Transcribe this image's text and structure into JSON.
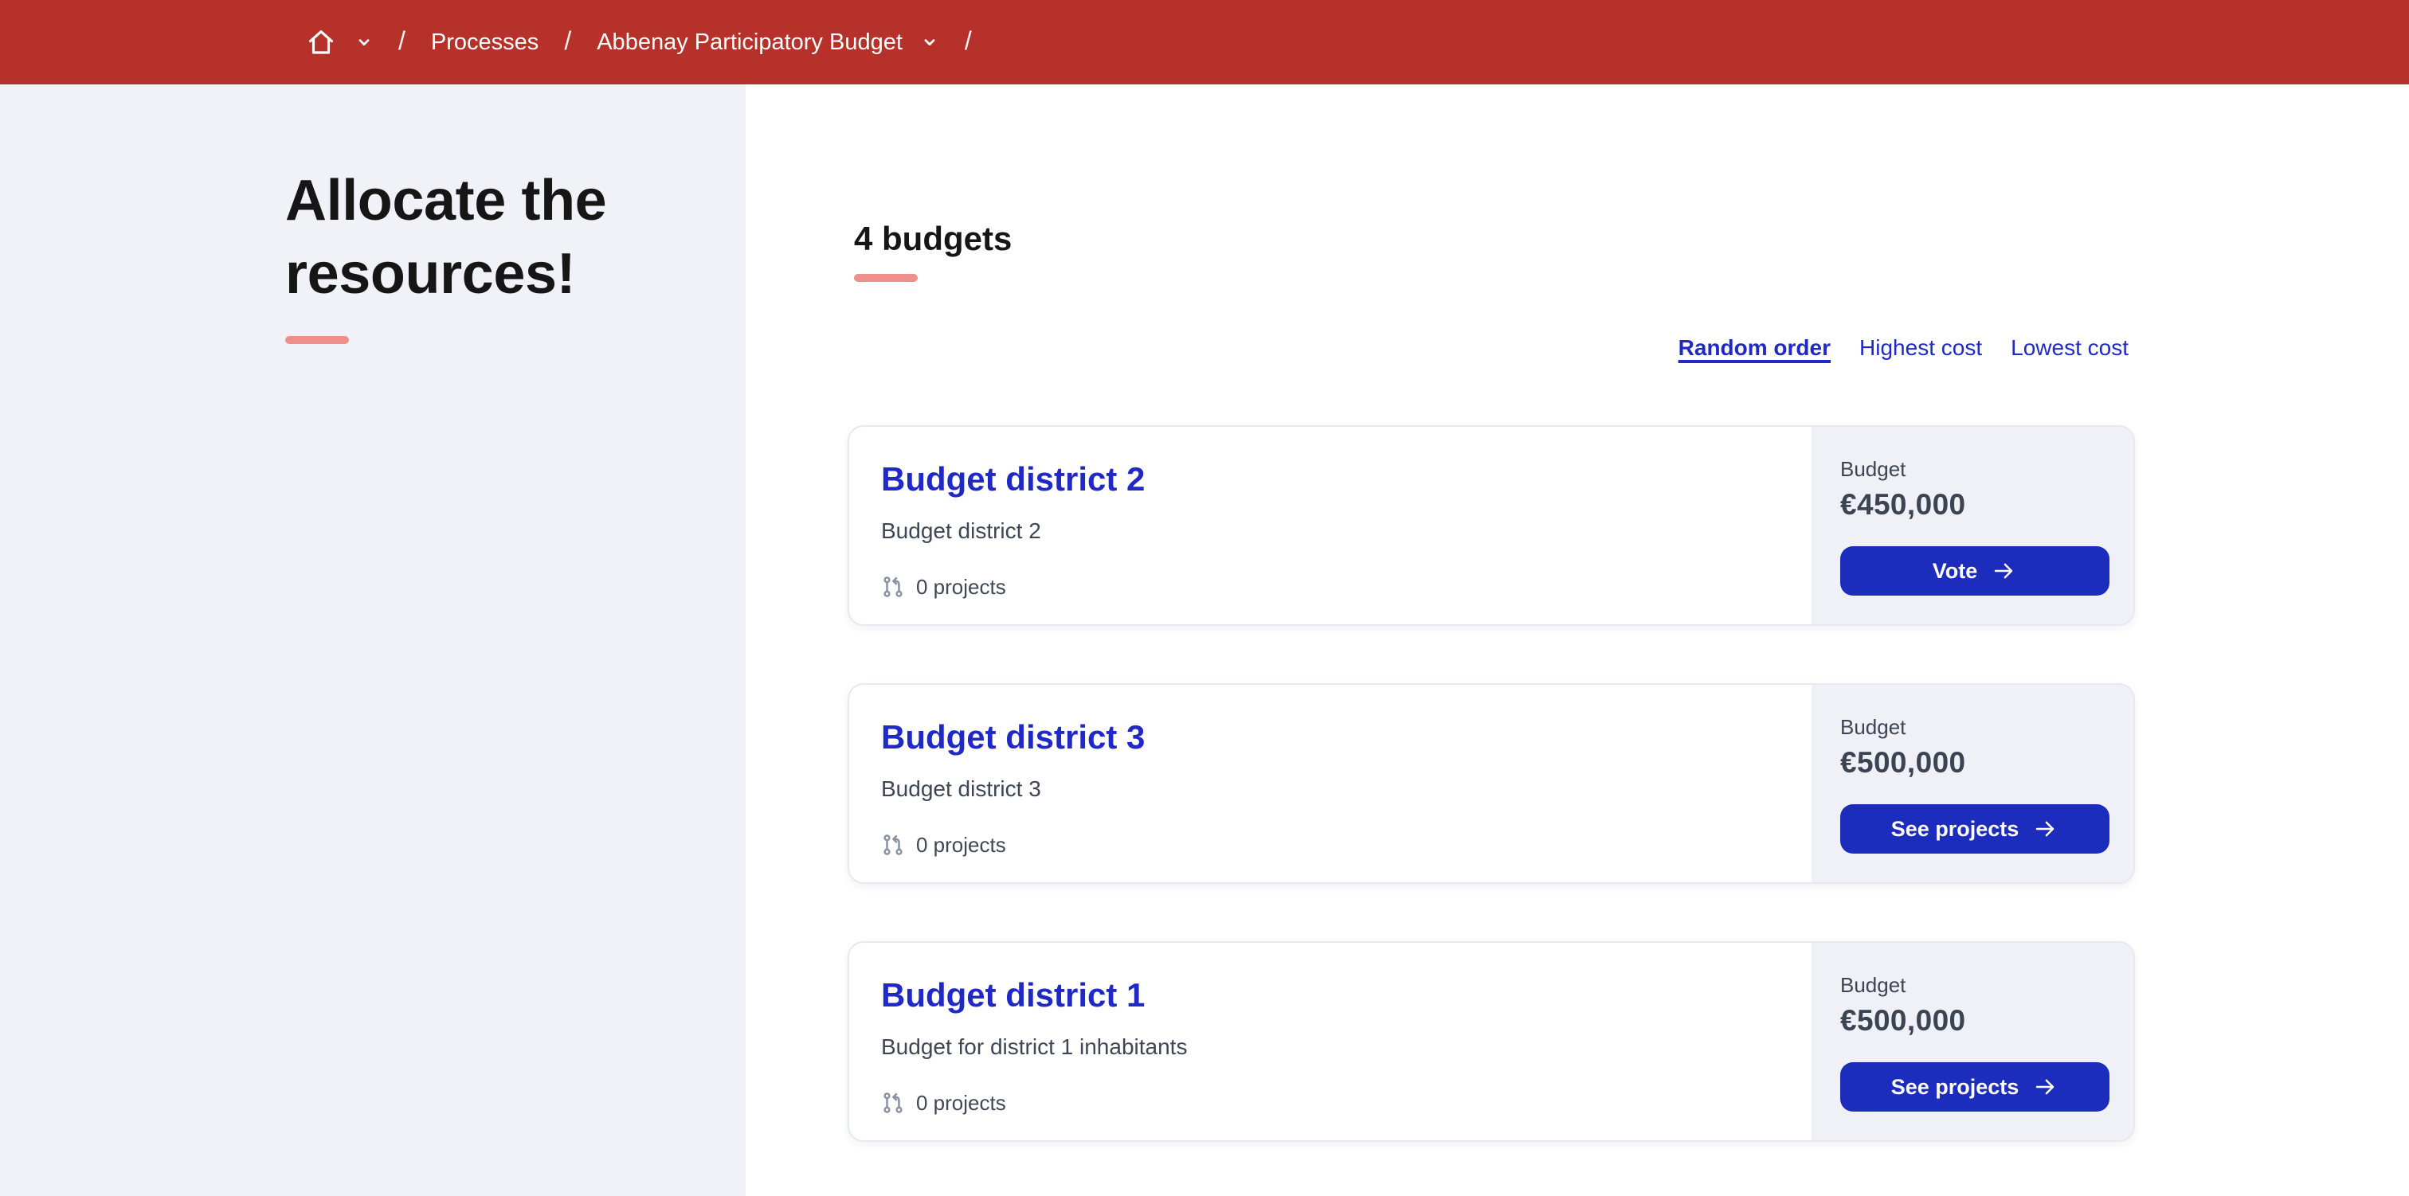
{
  "theme": {
    "header_bg": "#b53129",
    "accent_underline": "#ef8f8b",
    "link_blue": "#2029c6",
    "button_blue": "#1c2cbd",
    "panel_gray": "#f0f1f6",
    "sidebar_gray": "#f1f2f7"
  },
  "breadcrumb": {
    "separator": "/",
    "items": [
      {
        "label": "Processes"
      },
      {
        "label": "Abbenay Participatory Budget"
      }
    ]
  },
  "sidebar": {
    "title": "Allocate the resources!"
  },
  "main": {
    "heading": "4 budgets",
    "sort_options": [
      {
        "label": "Random order",
        "active": true
      },
      {
        "label": "Highest cost",
        "active": false
      },
      {
        "label": "Lowest cost",
        "active": false
      }
    ],
    "cards": [
      {
        "title": "Budget district 2",
        "description": "Budget district 2",
        "projects_count": "0 projects",
        "budget_label": "Budget",
        "amount": "€450,000",
        "action_label": "Vote"
      },
      {
        "title": "Budget district 3",
        "description": "Budget district 3",
        "projects_count": "0 projects",
        "budget_label": "Budget",
        "amount": "€500,000",
        "action_label": "See projects"
      },
      {
        "title": "Budget district 1",
        "description": "Budget for district 1 inhabitants",
        "projects_count": "0 projects",
        "budget_label": "Budget",
        "amount": "€500,000",
        "action_label": "See projects"
      }
    ]
  },
  "icons": {
    "home": "home",
    "chevron_down": "chevron-down",
    "projects": "git-pull-request",
    "arrow_right": "arrow-right"
  }
}
